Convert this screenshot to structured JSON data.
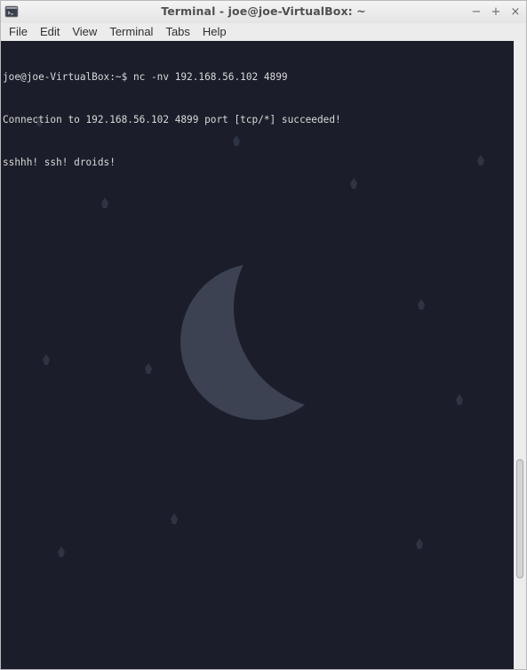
{
  "window": {
    "title": "Terminal - joe@joe-VirtualBox: ~"
  },
  "window_controls": {
    "minimize": "−",
    "maximize": "+",
    "close": "×"
  },
  "menubar": {
    "items": [
      "File",
      "Edit",
      "View",
      "Terminal",
      "Tabs",
      "Help"
    ]
  },
  "terminal": {
    "lines": [
      "joe@joe-VirtualBox:~$ nc -nv 192.168.56.102 4899",
      "Connection to 192.168.56.102 4899 port [tcp/*] succeeded!",
      "sshhh! ssh! droids!"
    ],
    "background_color": "#1b1e2a",
    "text_color": "#d9d9d9",
    "wallpaper": "crescent-moon-and-stars"
  },
  "icons": {
    "app": "terminal-icon"
  }
}
